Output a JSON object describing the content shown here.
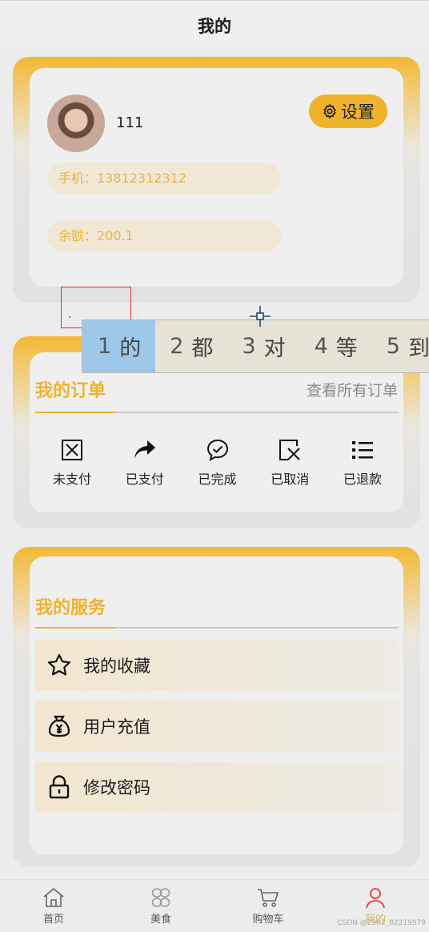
{
  "header": {
    "title": "我的"
  },
  "profile": {
    "username": "111",
    "settings_label": "设置",
    "phone_text": "手机：13812312312",
    "balance_text": "余额：200.1"
  },
  "orders": {
    "title": "我的订单",
    "view_all": "查看所有订单",
    "items": [
      {
        "label": "未支付",
        "icon": "unpaid-box-icon"
      },
      {
        "label": "已支付",
        "icon": "share-arrow-icon"
      },
      {
        "label": "已完成",
        "icon": "chat-check-icon"
      },
      {
        "label": "已取消",
        "icon": "cancel-doc-icon"
      },
      {
        "label": "已退款",
        "icon": "list-icon"
      }
    ]
  },
  "services": {
    "title": "我的服务",
    "items": [
      {
        "label": "我的收藏",
        "icon": "star-icon"
      },
      {
        "label": "用户充值",
        "icon": "money-bag-icon"
      },
      {
        "label": "修改密码",
        "icon": "lock-icon"
      }
    ]
  },
  "tabbar": {
    "items": [
      {
        "label": "首页",
        "icon": "home-icon"
      },
      {
        "label": "美食",
        "icon": "food-grid-icon"
      },
      {
        "label": "购物车",
        "icon": "cart-icon"
      },
      {
        "label": "我的",
        "icon": "user-icon",
        "active": true
      }
    ]
  },
  "ime": {
    "candidates": [
      {
        "num": "1",
        "text": "的"
      },
      {
        "num": "2",
        "text": "都"
      },
      {
        "num": "3",
        "text": "对"
      },
      {
        "num": "4",
        "text": "等"
      },
      {
        "num": "5",
        "text": "到"
      }
    ]
  },
  "watermark": "CSDN @2302_82219979",
  "colors": {
    "accent": "#f0b22a",
    "pill_bg": "#f0e8d5",
    "pill_text": "#e8b44a",
    "ime_highlight": "#9ec8ea"
  }
}
